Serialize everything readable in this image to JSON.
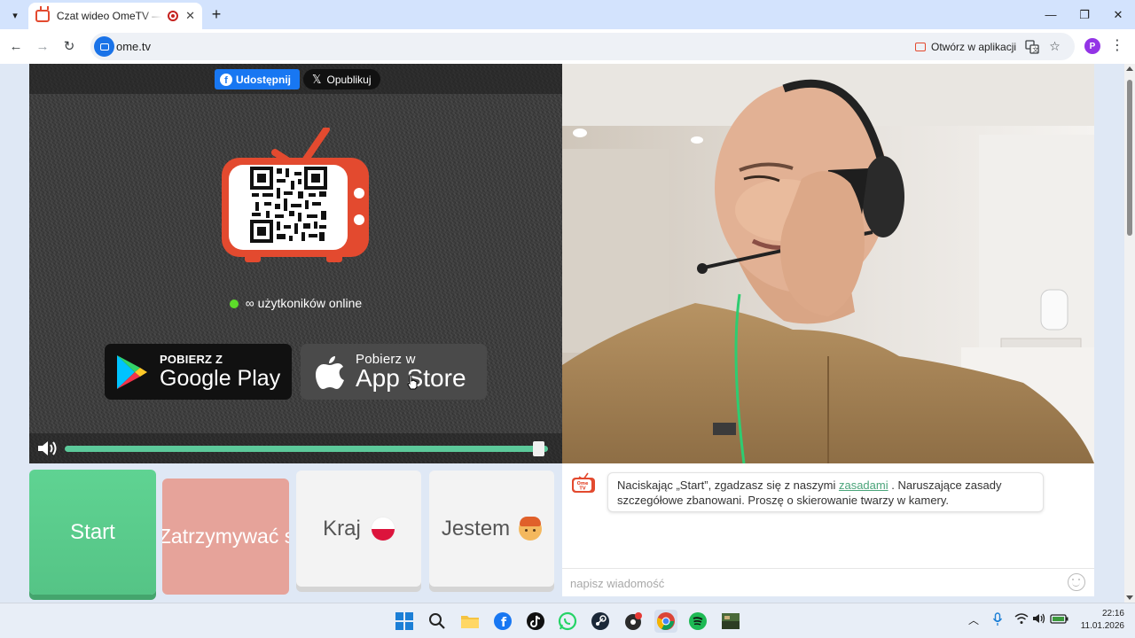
{
  "browser": {
    "tab_title": "Czat wideo OmeTV — alternatywa",
    "url": "ome.tv",
    "open_in_app": "Otwórz w aplikacji",
    "profile_initial": "P"
  },
  "share": {
    "facebook": "Udostępnij",
    "x": "Opublikuj"
  },
  "online": {
    "count": "∞",
    "label": "użytkoników online"
  },
  "stores": {
    "google_small": "POBIERZ Z",
    "google_big": "Google Play",
    "apple_small": "Pobierz w",
    "apple_big": "App Store"
  },
  "volume": {
    "level": 0.98
  },
  "controls": {
    "start": "Start",
    "stop": "Zatrzymywać się",
    "country": "Kraj",
    "gender": "Jestem"
  },
  "chat": {
    "logo_text": "Ome TV",
    "msg_before": "Naciskając „Start”, zgadzasz się z naszymi ",
    "msg_link": "zasadami",
    "msg_after": " . Naruszające zasady szczegółowe zbanowani. Proszę o skierowanie twarzy w kamery.",
    "placeholder": "napisz wiadomość"
  },
  "taskbar": {
    "time": "22:16",
    "date": "11.01.2026"
  },
  "colors": {
    "accent_green": "#55c486",
    "stop_red": "#e6a39a",
    "ometv_orange": "#e34a2f"
  }
}
